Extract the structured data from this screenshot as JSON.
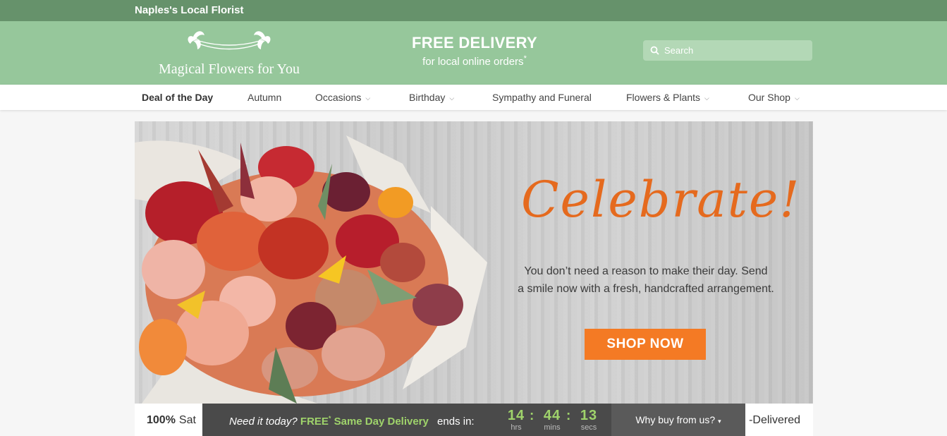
{
  "topbar": {
    "tagline": "Naples's Local Florist"
  },
  "header": {
    "logo_name": "Magical Flowers for You",
    "promo_title": "FREE DELIVERY",
    "promo_subtitle": "for local online orders",
    "promo_mark": "*",
    "search_placeholder": "Search"
  },
  "nav": {
    "items": [
      {
        "label": "Deal of the Day",
        "dropdown": false
      },
      {
        "label": "Autumn",
        "dropdown": false
      },
      {
        "label": "Occasions",
        "dropdown": true
      },
      {
        "label": "Birthday",
        "dropdown": true
      },
      {
        "label": "Sympathy and Funeral",
        "dropdown": false
      },
      {
        "label": "Flowers & Plants",
        "dropdown": true
      },
      {
        "label": "Our Shop",
        "dropdown": true
      }
    ]
  },
  "hero": {
    "headline": "Celebrate!",
    "line1": "You don’t need a reason to make their day. Send",
    "line2": "a smile now with a fresh, handcrafted arrangement.",
    "cta": "SHOP NOW"
  },
  "guarantee": {
    "left_bold": "100%",
    "left_text": "Sat",
    "right_text": "-Delivered"
  },
  "delivery_bar": {
    "question": "Need it today?",
    "free": "FREE",
    "free_mark": "*",
    "service": "Same Day Delivery",
    "ends": "ends in:",
    "countdown": [
      {
        "value": "14",
        "unit": "hrs"
      },
      {
        "value": "44",
        "unit": "mins"
      },
      {
        "value": "13",
        "unit": "secs"
      }
    ],
    "separator": ":",
    "why_label": "Why buy from us?",
    "why_caret": "▾"
  },
  "colors": {
    "topbar": "#66926b",
    "header": "#96c79b",
    "accent_orange": "#f47a24",
    "timer_green": "#9fd36b",
    "delivery_bar": "#4a4a4a"
  },
  "icons": [
    "search-icon",
    "flower-logo-icon",
    "chevron-down-icon",
    "caret-down-icon"
  ]
}
